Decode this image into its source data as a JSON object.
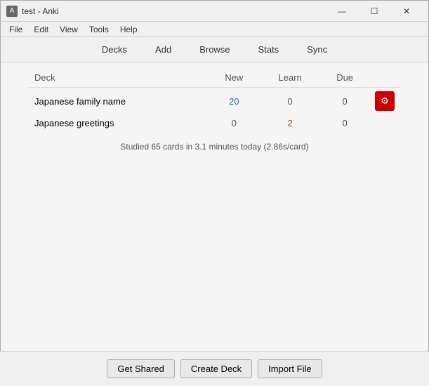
{
  "window": {
    "title": "test - Anki",
    "icon": "A"
  },
  "titlebar_controls": {
    "minimize": "—",
    "maximize": "☐",
    "close": "✕"
  },
  "menubar": {
    "items": [
      "File",
      "Edit",
      "View",
      "Tools",
      "Help"
    ]
  },
  "toolbar": {
    "items": [
      "Decks",
      "Add",
      "Browse",
      "Stats",
      "Sync"
    ]
  },
  "deck_table": {
    "headers": {
      "deck": "Deck",
      "new": "New",
      "learn": "Learn",
      "due": "Due"
    },
    "rows": [
      {
        "name": "Japanese family name",
        "new": 20,
        "learn": 0,
        "due": 0,
        "has_gear": true,
        "gear_active": true
      },
      {
        "name": "Japanese greetings",
        "new": 0,
        "learn": 2,
        "due": 0,
        "has_gear": false,
        "gear_active": false
      }
    ],
    "stats": "Studied 65 cards in 3.1 minutes today (2.86s/card)"
  },
  "footer": {
    "buttons": [
      "Get Shared",
      "Create Deck",
      "Import File"
    ]
  }
}
